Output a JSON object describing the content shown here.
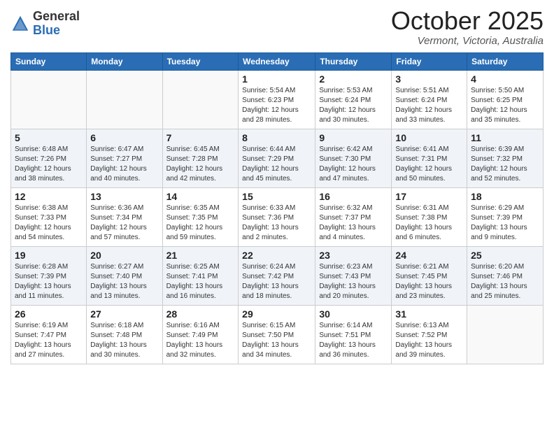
{
  "header": {
    "logo_general": "General",
    "logo_blue": "Blue",
    "month_title": "October 2025",
    "location": "Vermont, Victoria, Australia"
  },
  "days_of_week": [
    "Sunday",
    "Monday",
    "Tuesday",
    "Wednesday",
    "Thursday",
    "Friday",
    "Saturday"
  ],
  "weeks": [
    [
      {
        "day": "",
        "sunrise": "",
        "sunset": "",
        "daylight": ""
      },
      {
        "day": "",
        "sunrise": "",
        "sunset": "",
        "daylight": ""
      },
      {
        "day": "",
        "sunrise": "",
        "sunset": "",
        "daylight": ""
      },
      {
        "day": "1",
        "sunrise": "Sunrise: 5:54 AM",
        "sunset": "Sunset: 6:23 PM",
        "daylight": "Daylight: 12 hours and 28 minutes."
      },
      {
        "day": "2",
        "sunrise": "Sunrise: 5:53 AM",
        "sunset": "Sunset: 6:24 PM",
        "daylight": "Daylight: 12 hours and 30 minutes."
      },
      {
        "day": "3",
        "sunrise": "Sunrise: 5:51 AM",
        "sunset": "Sunset: 6:24 PM",
        "daylight": "Daylight: 12 hours and 33 minutes."
      },
      {
        "day": "4",
        "sunrise": "Sunrise: 5:50 AM",
        "sunset": "Sunset: 6:25 PM",
        "daylight": "Daylight: 12 hours and 35 minutes."
      }
    ],
    [
      {
        "day": "5",
        "sunrise": "Sunrise: 6:48 AM",
        "sunset": "Sunset: 7:26 PM",
        "daylight": "Daylight: 12 hours and 38 minutes."
      },
      {
        "day": "6",
        "sunrise": "Sunrise: 6:47 AM",
        "sunset": "Sunset: 7:27 PM",
        "daylight": "Daylight: 12 hours and 40 minutes."
      },
      {
        "day": "7",
        "sunrise": "Sunrise: 6:45 AM",
        "sunset": "Sunset: 7:28 PM",
        "daylight": "Daylight: 12 hours and 42 minutes."
      },
      {
        "day": "8",
        "sunrise": "Sunrise: 6:44 AM",
        "sunset": "Sunset: 7:29 PM",
        "daylight": "Daylight: 12 hours and 45 minutes."
      },
      {
        "day": "9",
        "sunrise": "Sunrise: 6:42 AM",
        "sunset": "Sunset: 7:30 PM",
        "daylight": "Daylight: 12 hours and 47 minutes."
      },
      {
        "day": "10",
        "sunrise": "Sunrise: 6:41 AM",
        "sunset": "Sunset: 7:31 PM",
        "daylight": "Daylight: 12 hours and 50 minutes."
      },
      {
        "day": "11",
        "sunrise": "Sunrise: 6:39 AM",
        "sunset": "Sunset: 7:32 PM",
        "daylight": "Daylight: 12 hours and 52 minutes."
      }
    ],
    [
      {
        "day": "12",
        "sunrise": "Sunrise: 6:38 AM",
        "sunset": "Sunset: 7:33 PM",
        "daylight": "Daylight: 12 hours and 54 minutes."
      },
      {
        "day": "13",
        "sunrise": "Sunrise: 6:36 AM",
        "sunset": "Sunset: 7:34 PM",
        "daylight": "Daylight: 12 hours and 57 minutes."
      },
      {
        "day": "14",
        "sunrise": "Sunrise: 6:35 AM",
        "sunset": "Sunset: 7:35 PM",
        "daylight": "Daylight: 12 hours and 59 minutes."
      },
      {
        "day": "15",
        "sunrise": "Sunrise: 6:33 AM",
        "sunset": "Sunset: 7:36 PM",
        "daylight": "Daylight: 13 hours and 2 minutes."
      },
      {
        "day": "16",
        "sunrise": "Sunrise: 6:32 AM",
        "sunset": "Sunset: 7:37 PM",
        "daylight": "Daylight: 13 hours and 4 minutes."
      },
      {
        "day": "17",
        "sunrise": "Sunrise: 6:31 AM",
        "sunset": "Sunset: 7:38 PM",
        "daylight": "Daylight: 13 hours and 6 minutes."
      },
      {
        "day": "18",
        "sunrise": "Sunrise: 6:29 AM",
        "sunset": "Sunset: 7:39 PM",
        "daylight": "Daylight: 13 hours and 9 minutes."
      }
    ],
    [
      {
        "day": "19",
        "sunrise": "Sunrise: 6:28 AM",
        "sunset": "Sunset: 7:39 PM",
        "daylight": "Daylight: 13 hours and 11 minutes."
      },
      {
        "day": "20",
        "sunrise": "Sunrise: 6:27 AM",
        "sunset": "Sunset: 7:40 PM",
        "daylight": "Daylight: 13 hours and 13 minutes."
      },
      {
        "day": "21",
        "sunrise": "Sunrise: 6:25 AM",
        "sunset": "Sunset: 7:41 PM",
        "daylight": "Daylight: 13 hours and 16 minutes."
      },
      {
        "day": "22",
        "sunrise": "Sunrise: 6:24 AM",
        "sunset": "Sunset: 7:42 PM",
        "daylight": "Daylight: 13 hours and 18 minutes."
      },
      {
        "day": "23",
        "sunrise": "Sunrise: 6:23 AM",
        "sunset": "Sunset: 7:43 PM",
        "daylight": "Daylight: 13 hours and 20 minutes."
      },
      {
        "day": "24",
        "sunrise": "Sunrise: 6:21 AM",
        "sunset": "Sunset: 7:45 PM",
        "daylight": "Daylight: 13 hours and 23 minutes."
      },
      {
        "day": "25",
        "sunrise": "Sunrise: 6:20 AM",
        "sunset": "Sunset: 7:46 PM",
        "daylight": "Daylight: 13 hours and 25 minutes."
      }
    ],
    [
      {
        "day": "26",
        "sunrise": "Sunrise: 6:19 AM",
        "sunset": "Sunset: 7:47 PM",
        "daylight": "Daylight: 13 hours and 27 minutes."
      },
      {
        "day": "27",
        "sunrise": "Sunrise: 6:18 AM",
        "sunset": "Sunset: 7:48 PM",
        "daylight": "Daylight: 13 hours and 30 minutes."
      },
      {
        "day": "28",
        "sunrise": "Sunrise: 6:16 AM",
        "sunset": "Sunset: 7:49 PM",
        "daylight": "Daylight: 13 hours and 32 minutes."
      },
      {
        "day": "29",
        "sunrise": "Sunrise: 6:15 AM",
        "sunset": "Sunset: 7:50 PM",
        "daylight": "Daylight: 13 hours and 34 minutes."
      },
      {
        "day": "30",
        "sunrise": "Sunrise: 6:14 AM",
        "sunset": "Sunset: 7:51 PM",
        "daylight": "Daylight: 13 hours and 36 minutes."
      },
      {
        "day": "31",
        "sunrise": "Sunrise: 6:13 AM",
        "sunset": "Sunset: 7:52 PM",
        "daylight": "Daylight: 13 hours and 39 minutes."
      },
      {
        "day": "",
        "sunrise": "",
        "sunset": "",
        "daylight": ""
      }
    ]
  ]
}
